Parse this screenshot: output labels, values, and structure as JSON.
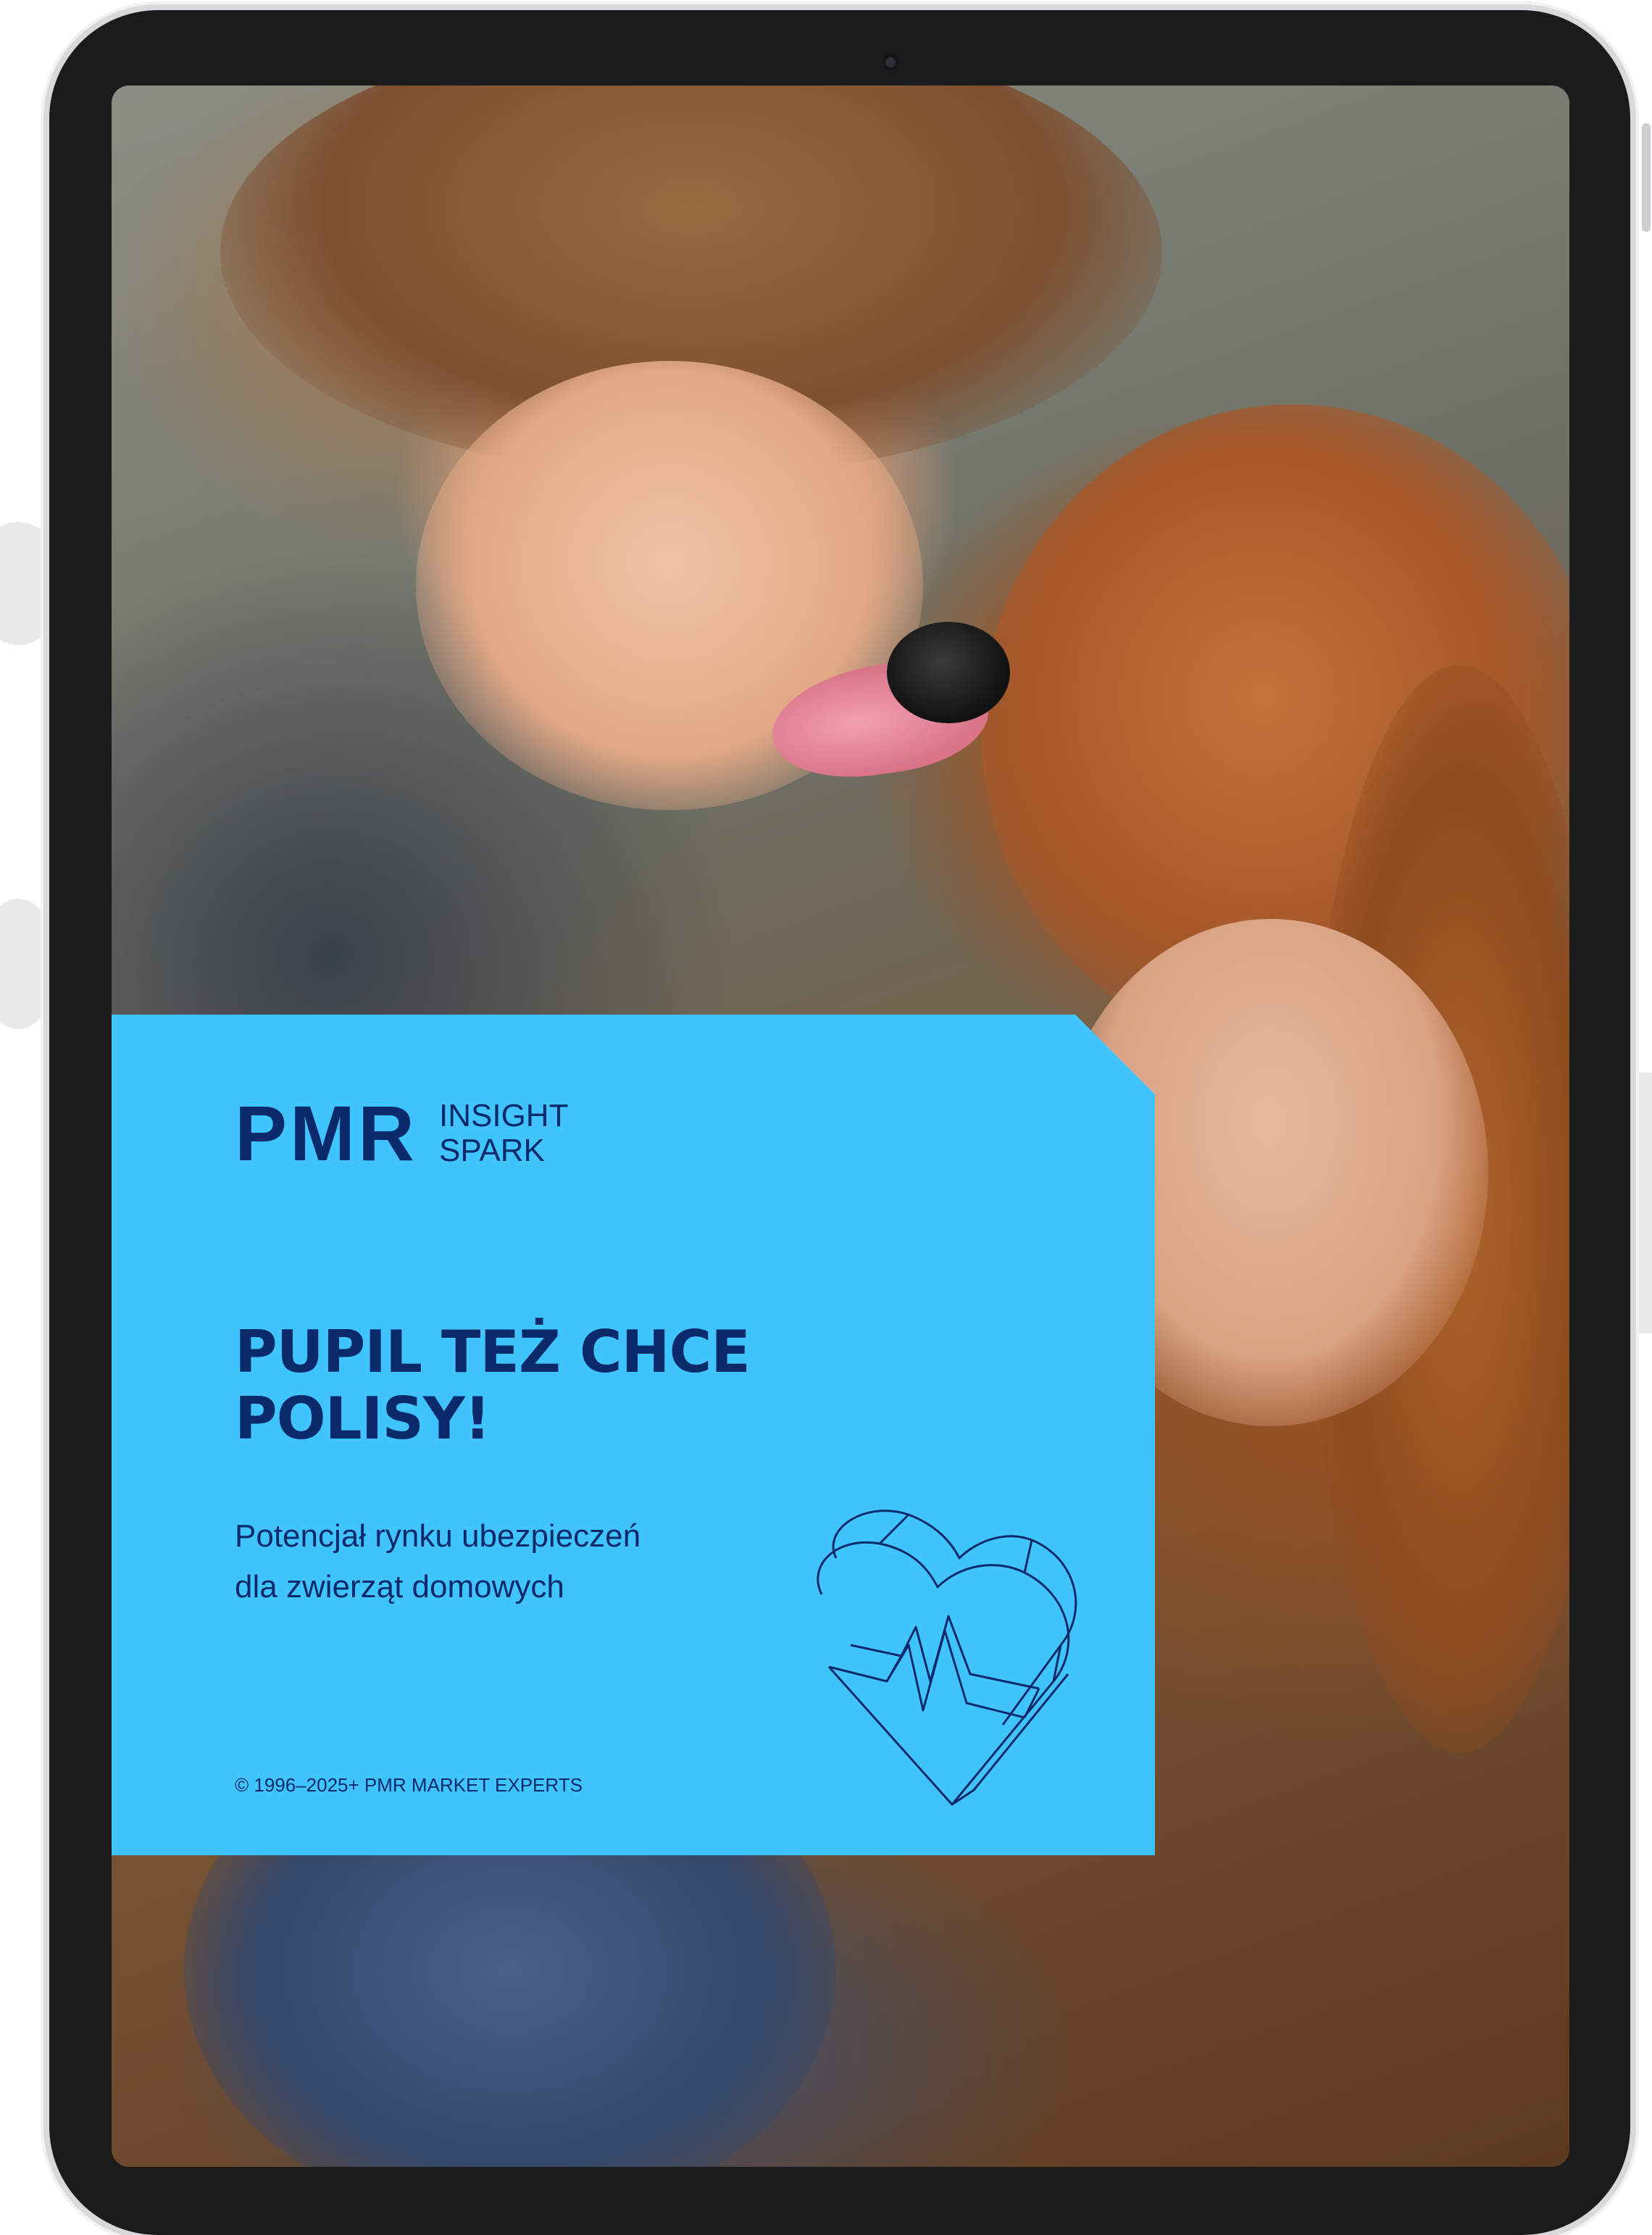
{
  "brand": {
    "logo_main": "PMR",
    "logo_line1": "INSIGHT",
    "logo_line2": "SPARK"
  },
  "cover": {
    "title_line1": "PUPIL TEŻ CHCE",
    "title_line2": "POLISY!",
    "subtitle_line1": "Potencjał rynku ubezpieczeń",
    "subtitle_line2": "dla zwierząt domowych",
    "copyright": "© 1996–2025+ PMR MARKET EXPERTS"
  },
  "colors": {
    "panel": "#3fc4fd",
    "text": "#0a2a6b",
    "bezel": "#1b1b1b"
  },
  "icons": [
    "heart-pulse-icon",
    "camera-icon"
  ]
}
